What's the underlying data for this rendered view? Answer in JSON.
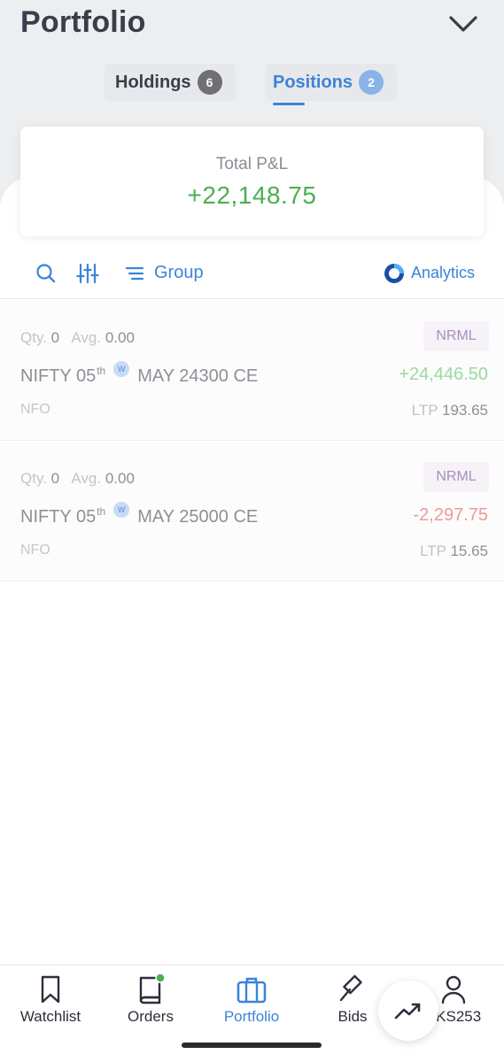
{
  "header": {
    "title": "Portfolio"
  },
  "tabs": [
    {
      "label": "Holdings",
      "count": "6"
    },
    {
      "label": "Positions",
      "count": "2"
    }
  ],
  "summary": {
    "label": "Total P&L",
    "value": "+22,148.75"
  },
  "toolbar": {
    "group_label": "Group",
    "analytics_label": "Analytics"
  },
  "positions": [
    {
      "qty_label": "Qty.",
      "qty": "0",
      "avg_label": "Avg.",
      "avg": "0.00",
      "product": "NRML",
      "symbol_pre": "NIFTY 05",
      "symbol_sup": "th",
      "weekly_badge": "W",
      "symbol_post": "MAY 24300 CE",
      "pnl": "+24,446.50",
      "exchange": "NFO",
      "ltp_label": "LTP",
      "ltp": "193.65"
    },
    {
      "qty_label": "Qty.",
      "qty": "0",
      "avg_label": "Avg.",
      "avg": "0.00",
      "product": "NRML",
      "symbol_pre": "NIFTY 05",
      "symbol_sup": "th",
      "weekly_badge": "W",
      "symbol_post": "MAY 25000 CE",
      "pnl": "-2,297.75",
      "exchange": "NFO",
      "ltp_label": "LTP",
      "ltp": "15.65"
    }
  ],
  "bottom_nav": [
    {
      "label": "Watchlist",
      "icon": "bookmark-icon"
    },
    {
      "label": "Orders",
      "icon": "book-icon"
    },
    {
      "label": "Portfolio",
      "icon": "briefcase-icon"
    },
    {
      "label": "Bids",
      "icon": "gavel-icon"
    },
    {
      "label": "SKS253",
      "icon": "user-icon"
    }
  ],
  "colors": {
    "accent": "#3b84d8",
    "profit": "#4caf50",
    "loss": "#ec9a9a"
  }
}
